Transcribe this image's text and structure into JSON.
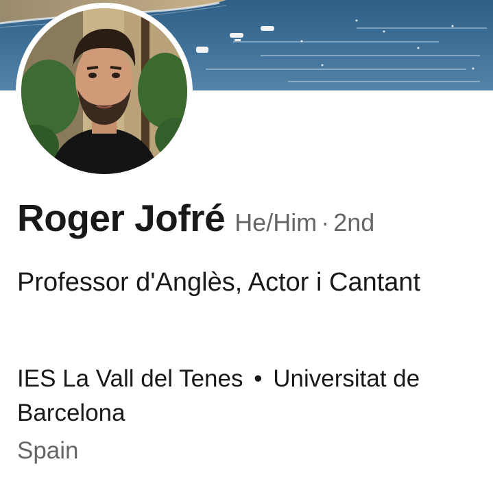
{
  "profile": {
    "name": "Roger Jofré",
    "pronouns": "He/Him",
    "separator": "·",
    "connection_degree": "2nd",
    "headline": "Professor d'Anglès, Actor i Cantant",
    "education": {
      "school_1": "IES La Vall del Tenes",
      "bullet": "•",
      "school_2": "Universitat de Barcelona"
    },
    "location": "Spain"
  },
  "images": {
    "cover": "coastal-sea-photo",
    "avatar": "profile-photo"
  },
  "colors": {
    "text_primary": "#191919",
    "text_secondary": "#666666",
    "sea": "#3f6f94",
    "background": "#ffffff"
  }
}
